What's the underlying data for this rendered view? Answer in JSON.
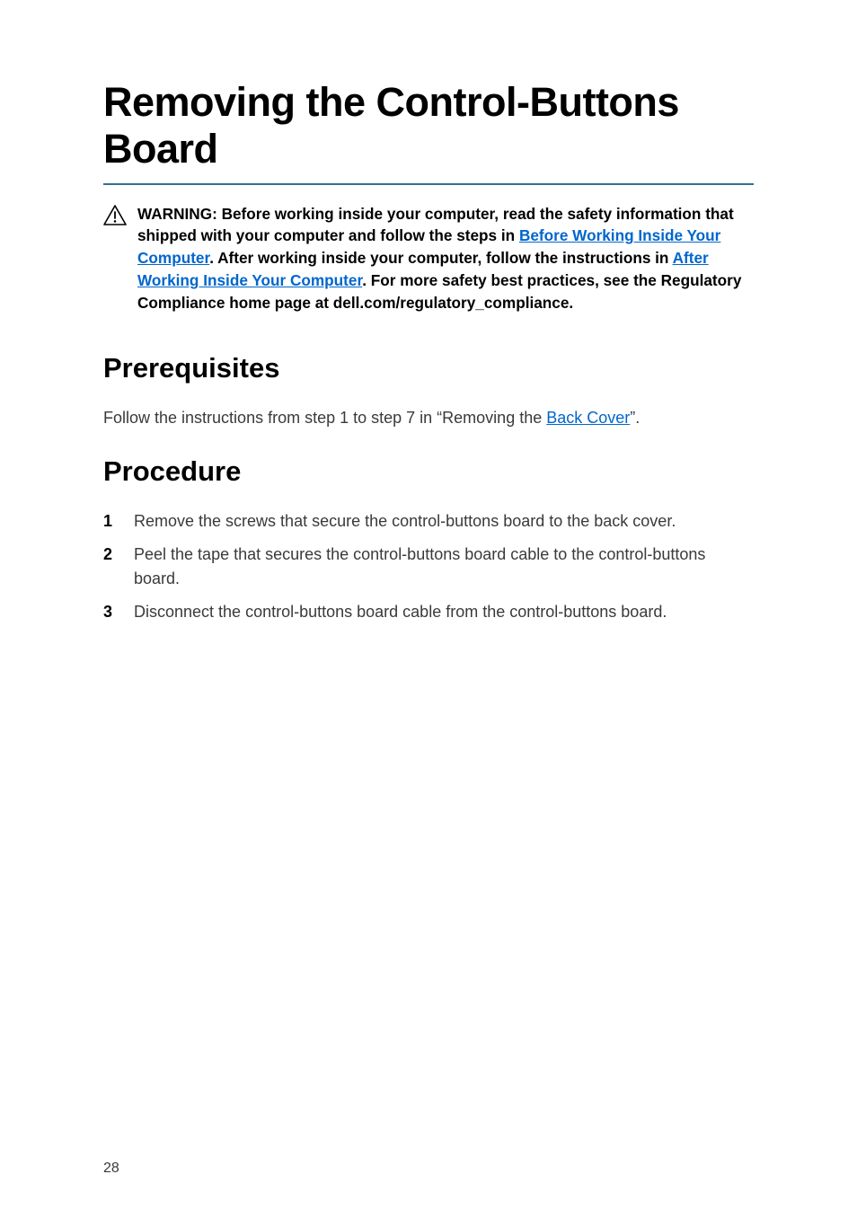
{
  "title": "Removing the Control-Buttons Board",
  "warning": {
    "parts": [
      {
        "text": "WARNING: Before working inside your computer, read the safety information that shipped with your computer and follow the steps in "
      },
      {
        "text": "Before Working Inside Your Computer",
        "link": true
      },
      {
        "text": ". After working inside your computer, follow the instructions in "
      },
      {
        "text": "After Working Inside Your Computer",
        "link": true
      },
      {
        "text": ". For more safety best practices, see the Regulatory Compliance home page at dell.com/regulatory_compliance."
      }
    ]
  },
  "sections": {
    "prerequisites": {
      "heading": "Prerequisites",
      "paragraph_parts": [
        {
          "text": "Follow the instructions from step 1 to step 7 in “Removing the "
        },
        {
          "text": "Back Cover",
          "link": true
        },
        {
          "text": "”."
        }
      ]
    },
    "procedure": {
      "heading": "Procedure",
      "steps": [
        "Remove the screws that secure the control-buttons board to the back cover.",
        "Peel the tape that secures the control-buttons board cable to the control-buttons board.",
        "Disconnect the control-buttons board cable from the control-buttons board."
      ]
    }
  },
  "page_number": "28"
}
